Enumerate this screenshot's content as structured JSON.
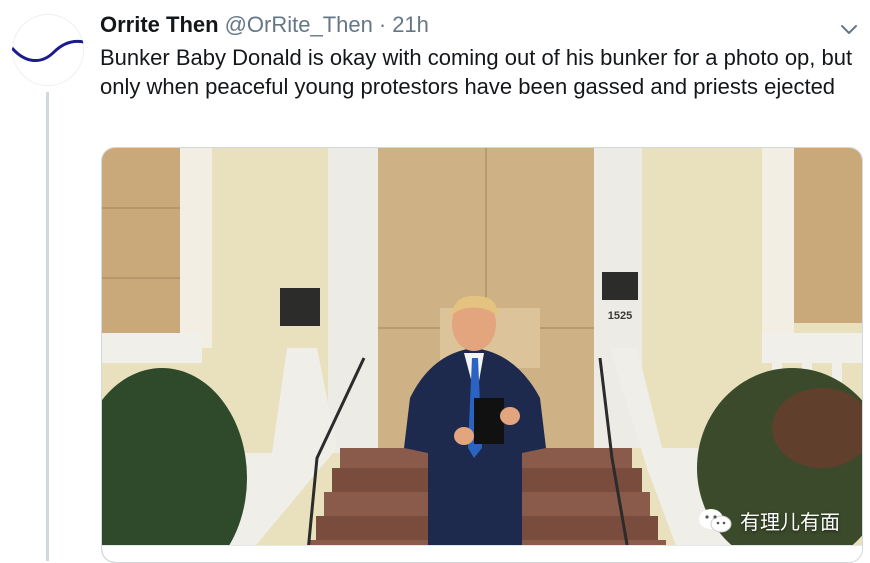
{
  "tweet": {
    "display_name": "Orrite Then",
    "handle": "@OrRite_Then",
    "separator": "·",
    "time": "21h",
    "text": "Bunker Baby Donald is okay with coming out of his bunker for a photo op, but only when peaceful young protestors have been gassed and priests ejected",
    "menu_icon": "chevron-down-icon"
  },
  "media": {
    "building_number": "1525",
    "watermark": "有理儿有面",
    "watermark_icon": "wechat-icon"
  },
  "colors": {
    "text": "#14171a",
    "secondary": "#657786",
    "avatar_wave": "#1b1b8f",
    "thread_line": "#cfd9de"
  }
}
